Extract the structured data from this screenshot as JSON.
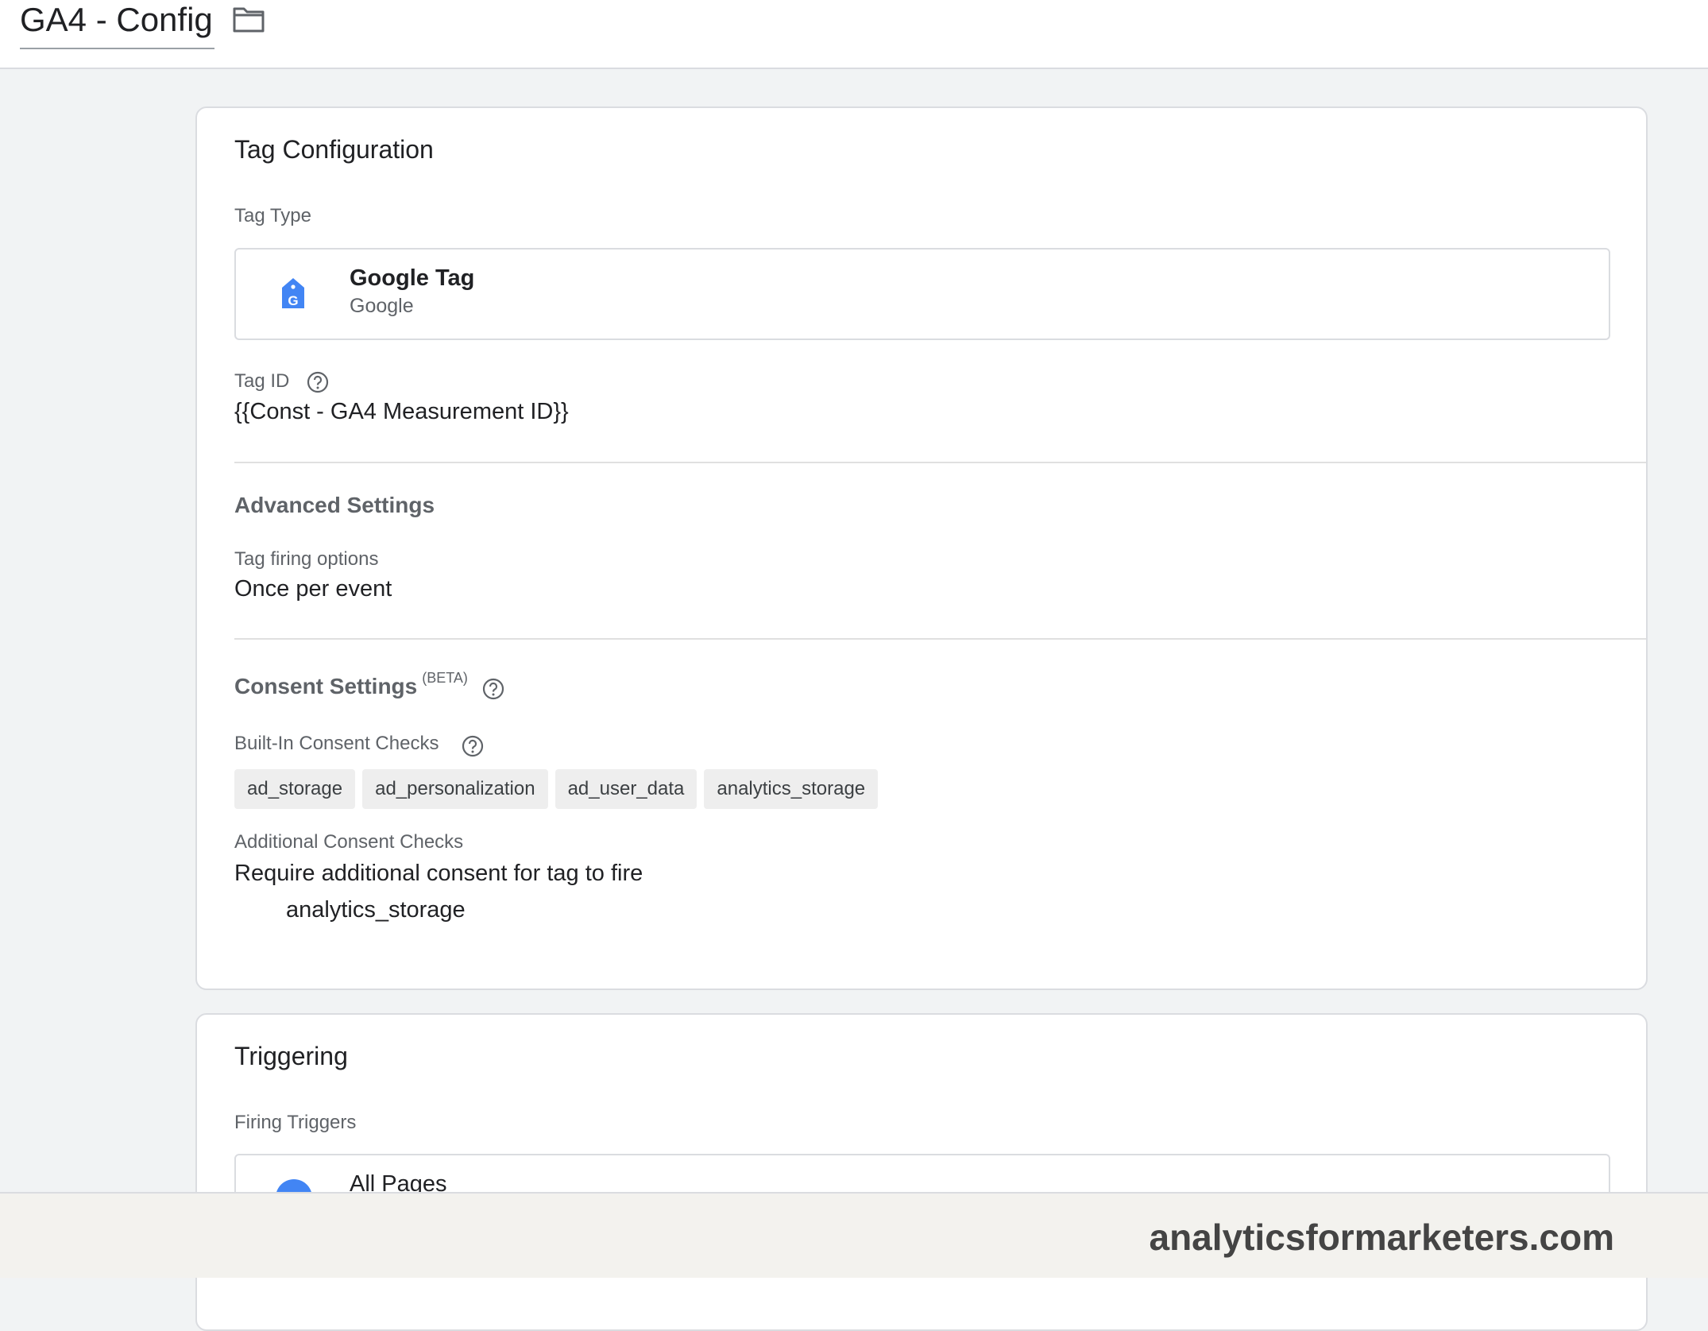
{
  "header": {
    "tag_name": "GA4 - Config"
  },
  "tag_configuration": {
    "title": "Tag Configuration",
    "tag_type_label": "Tag Type",
    "tag_type": {
      "name": "Google Tag",
      "vendor": "Google",
      "icon_glyph": "G"
    },
    "tag_id_label": "Tag ID",
    "tag_id_value": "{{Const - GA4 Measurement ID}}",
    "advanced": {
      "title": "Advanced Settings",
      "firing_label": "Tag firing options",
      "firing_value": "Once per event"
    },
    "consent": {
      "title": "Consent Settings",
      "badge": "(BETA)",
      "builtin_label": "Built-In Consent Checks",
      "builtin_chips": [
        "ad_storage",
        "ad_personalization",
        "ad_user_data",
        "analytics_storage"
      ],
      "additional_label": "Additional Consent Checks",
      "additional_value": "Require additional consent for tag to fire",
      "additional_item": "analytics_storage"
    }
  },
  "triggering": {
    "title": "Triggering",
    "firing_triggers_label": "Firing Triggers",
    "trigger_name": "All Pages"
  },
  "footer": {
    "brand": "analyticsformarketers.com"
  },
  "colors": {
    "accent": "#4285f4",
    "background": "#f1f3f4",
    "border": "#dadce0"
  }
}
